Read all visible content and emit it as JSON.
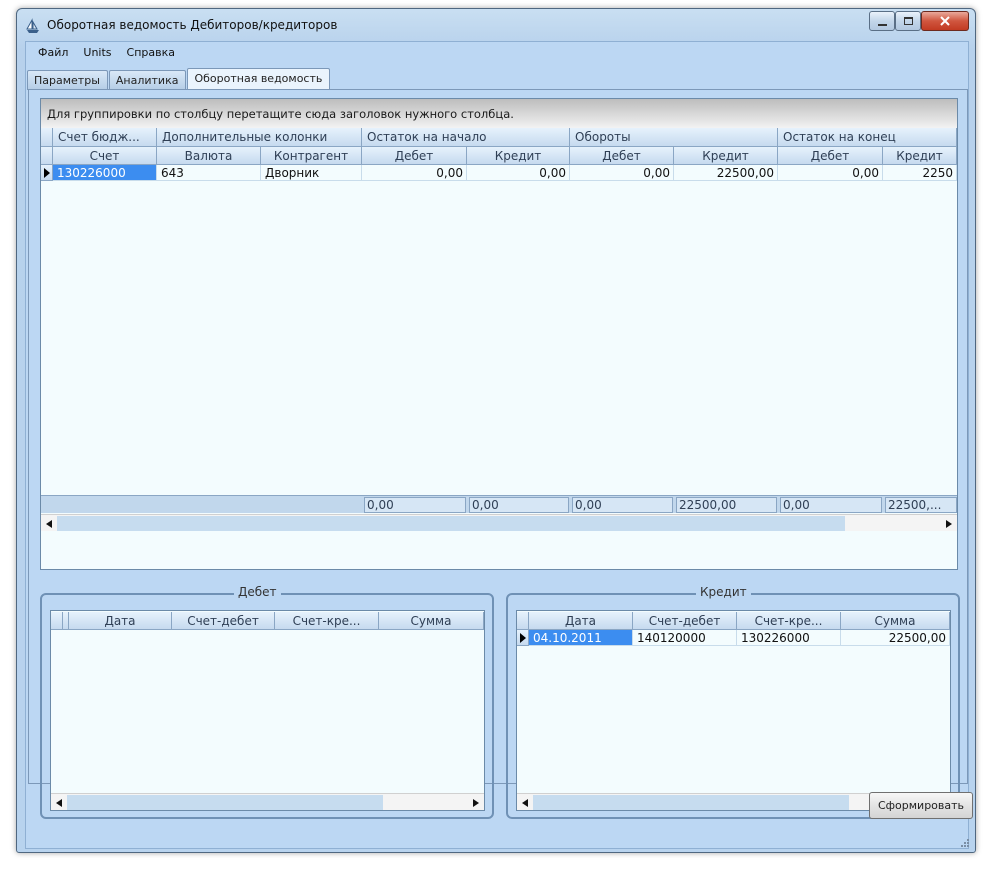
{
  "window": {
    "title": "Оборотная ведомость Дебиторов/кредиторов"
  },
  "menu": [
    "Файл",
    "Units",
    "Справка"
  ],
  "tabs": [
    "Параметры",
    "Аналитика",
    "Оборотная ведомость"
  ],
  "active_tab": 2,
  "main_grid": {
    "group_panel_text": "Для группировки по столбцу перетащите сюда заголовок нужного столбца.",
    "bands": [
      "Счет бюдж...",
      "Дополнительные колонки",
      "Остаток на начало",
      "Обороты",
      "Остаток на конец"
    ],
    "columns": [
      "Счет",
      "Валюта",
      "Контрагент",
      "Дебет",
      "Кредит",
      "Дебет",
      "Кредит",
      "Дебет",
      "Кредит"
    ],
    "rows": [
      [
        "130226000",
        "643",
        "Дворник",
        "0,00",
        "0,00",
        "0,00",
        "22500,00",
        "0,00",
        "2250"
      ]
    ],
    "footer": [
      "0,00",
      "0,00",
      "0,00",
      "22500,00",
      "0,00",
      "22500,..."
    ]
  },
  "debit_panel": {
    "title": "Дебет",
    "columns": [
      "Дата",
      "Счет-дебет",
      "Счет-кре...",
      "Сумма"
    ],
    "rows": []
  },
  "credit_panel": {
    "title": "Кредит",
    "columns": [
      "Дата",
      "Счет-дебет",
      "Счет-кре...",
      "Сумма"
    ],
    "rows": [
      [
        "04.10.2011",
        "140120000",
        "130226000",
        "22500,00"
      ]
    ]
  },
  "buttons": {
    "build": "Сформировать"
  },
  "icons": {
    "app": "ship-icon",
    "minimize": "minimize-icon",
    "maximize": "maximize-icon",
    "close": "close-icon"
  },
  "colors": {
    "selection": "#3c8df0",
    "client_bg": "#bcd7f3",
    "grid_bg": "#f3fcfe"
  }
}
